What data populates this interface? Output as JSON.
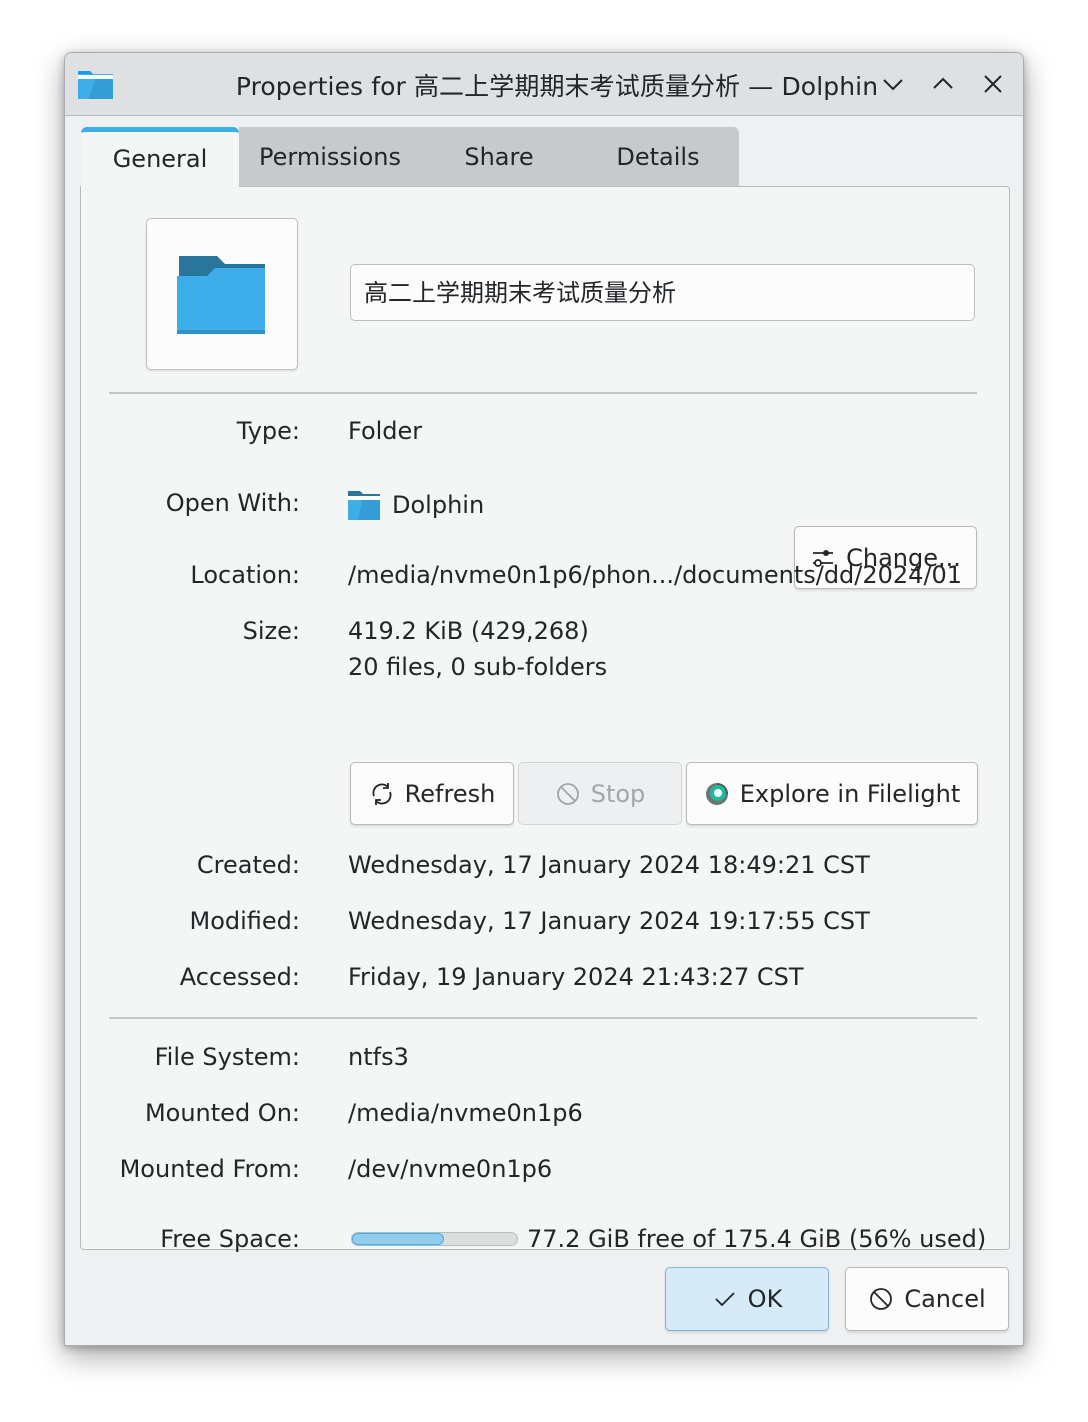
{
  "window": {
    "title": "Properties for 高二上学期期末考试质量分析 — Dolphin",
    "app_icon": "folder-icon",
    "controls": [
      "minimize",
      "maximize",
      "close"
    ]
  },
  "tabs": [
    {
      "label": "General",
      "active": true
    },
    {
      "label": "Permissions",
      "active": false
    },
    {
      "label": "Share",
      "active": false
    },
    {
      "label": "Details",
      "active": false
    }
  ],
  "general": {
    "name_value": "高二上学期期末考试质量分析",
    "type_label": "Type:",
    "type_value": "Folder",
    "open_with_label": "Open With:",
    "open_with_value": "Dolphin",
    "change_button": "Change...",
    "location_label": "Location:",
    "location_value": "/media/nvme0n1p6/phon.../documents/dd/2024/01",
    "size_label": "Size:",
    "size_value": "419.2 KiB (429,268)",
    "size_detail": "20 files, 0 sub-folders",
    "refresh_button": "Refresh",
    "stop_button": "Stop",
    "filelight_button": "Explore in Filelight",
    "created_label": "Created:",
    "created_value": "Wednesday, 17 January 2024 18:49:21 CST",
    "modified_label": "Modified:",
    "modified_value": "Wednesday, 17 January 2024 19:17:55 CST",
    "accessed_label": "Accessed:",
    "accessed_value": "Friday, 19 January 2024 21:43:27 CST",
    "filesystem_label": "File System:",
    "filesystem_value": "ntfs3",
    "mounted_on_label": "Mounted On:",
    "mounted_on_value": "/media/nvme0n1p6",
    "mounted_from_label": "Mounted From:",
    "mounted_from_value": "/dev/nvme0n1p6",
    "free_space_label": "Free Space:",
    "free_space_value": "77.2 GiB free of 175.4 GiB (56% used)",
    "used_percent": 56
  },
  "footer": {
    "ok_button": "OK",
    "cancel_button": "Cancel"
  },
  "colors": {
    "accent": "#3daee9",
    "folder_light": "#3daee9",
    "folder_dark": "#2a759c"
  }
}
